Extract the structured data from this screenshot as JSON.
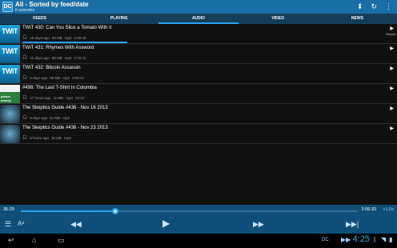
{
  "header": {
    "app_icon_label": "DC",
    "title": "All - Sorted by feed/date",
    "subtitle": "6 episodes",
    "icons": [
      "download-icon",
      "refresh-icon",
      "overflow-menu-icon"
    ]
  },
  "tabs": [
    {
      "label": "FEEDS",
      "active": false
    },
    {
      "label": "PLAYING",
      "active": false
    },
    {
      "label": "AUDIO",
      "active": true
    },
    {
      "label": "VIDEO",
      "active": false
    },
    {
      "label": "NEWS",
      "active": false
    }
  ],
  "episodes": [
    {
      "thumb": "TWiT",
      "title": "TWiT 430: Can You Slice a Tomato With it",
      "age": "19 days ago",
      "size": "69 MB",
      "type": "mp3",
      "duration": "2:06:33",
      "status": "Paused",
      "progress_fraction": 0.28
    },
    {
      "thumb": "TWiT",
      "title": "TWiT 431: Rhymes With Assword",
      "age": "12 days ago",
      "size": "58 MB",
      "type": "mp3",
      "duration": "2:20:41",
      "status": "",
      "progress_fraction": 0
    },
    {
      "thumb": "TWiT",
      "title": "TWiT 432: Bitcoin Assassin",
      "age": "5 days ago",
      "size": "59 MB",
      "type": "mp3",
      "duration": "2:09:44",
      "status": "",
      "progress_fraction": 0
    },
    {
      "thumb": "planet money",
      "title": "#498: The Last T-Shirt In Colombia",
      "age": "17 hours ago",
      "size": "11 MB",
      "type": "mp3",
      "duration": "23:24",
      "status": "",
      "progress_fraction": 0
    },
    {
      "thumb": "",
      "title": "The Skeptics Guide #436 - Nov 16 2013",
      "age": "8 days ago",
      "size": "51 MB",
      "type": "mp3",
      "duration": "",
      "status": "",
      "progress_fraction": 0
    },
    {
      "thumb": "",
      "title": "The Skeptics Guide #436 - Nov 23 2013",
      "age": "5 hours ago",
      "size": "32 MB",
      "type": "mp3",
      "duration": "",
      "status": "",
      "progress_fraction": 0
    }
  ],
  "player": {
    "elapsed": "35:29",
    "total": "2:06:33",
    "speed": "1.0x",
    "progress_fraction": 0.28
  },
  "system": {
    "clock": "4:25",
    "dc_label": "DC"
  },
  "colors": {
    "accent": "#28a4f0",
    "header": "#1b6fa7",
    "player": "#0f4f7a"
  }
}
